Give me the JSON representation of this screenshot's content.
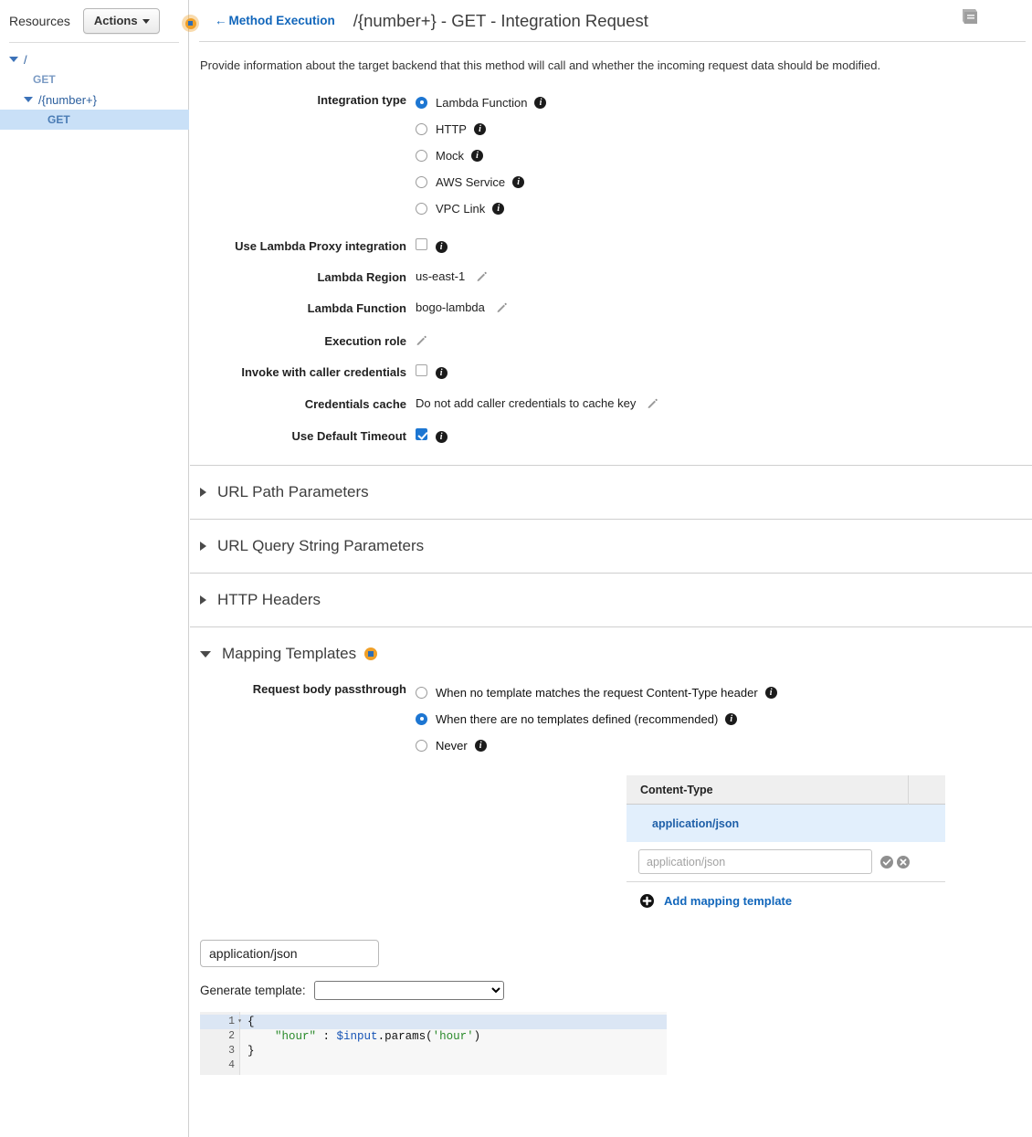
{
  "sidebar": {
    "title": "Resources",
    "actions_label": "Actions",
    "tree": [
      {
        "label": "/",
        "type": "resource",
        "expanded": true,
        "level": 0,
        "selected": false
      },
      {
        "label": "GET",
        "type": "method",
        "expanded": null,
        "level": 1,
        "selected": false
      },
      {
        "label": "/{number+}",
        "type": "resource",
        "expanded": true,
        "level": 2,
        "selected": false
      },
      {
        "label": "GET",
        "type": "method",
        "expanded": null,
        "level": 3,
        "selected": true
      }
    ]
  },
  "header": {
    "back_label": "Method Execution",
    "back_arrow": "←",
    "title": "/{number+} - GET - Integration Request",
    "doc_icon": "book-icon"
  },
  "intro": "Provide information about the target backend that this method will call and whether the incoming request data should be modified.",
  "form": {
    "integration_type": {
      "label": "Integration type",
      "options": [
        {
          "label": "Lambda Function",
          "selected": true
        },
        {
          "label": "HTTP",
          "selected": false
        },
        {
          "label": "Mock",
          "selected": false
        },
        {
          "label": "AWS Service",
          "selected": false
        },
        {
          "label": "VPC Link",
          "selected": false
        }
      ]
    },
    "lambda_proxy": {
      "label": "Use Lambda Proxy integration",
      "checked": false
    },
    "lambda_region": {
      "label": "Lambda Region",
      "value": "us-east-1"
    },
    "lambda_function": {
      "label": "Lambda Function",
      "value": "bogo-lambda"
    },
    "execution_role": {
      "label": "Execution role",
      "value": ""
    },
    "caller_credentials": {
      "label": "Invoke with caller credentials",
      "checked": false
    },
    "credentials_cache": {
      "label": "Credentials cache",
      "value": "Do not add caller credentials to cache key"
    },
    "default_timeout": {
      "label": "Use Default Timeout",
      "checked": true
    }
  },
  "sections": [
    {
      "title": "URL Path Parameters",
      "expanded": false,
      "marked": false
    },
    {
      "title": "URL Query String Parameters",
      "expanded": false,
      "marked": false
    },
    {
      "title": "HTTP Headers",
      "expanded": false,
      "marked": false
    },
    {
      "title": "Mapping Templates",
      "expanded": true,
      "marked": true
    }
  ],
  "mapping_templates": {
    "passthrough": {
      "label": "Request body passthrough",
      "options": [
        {
          "label": "When no template matches the request Content-Type header",
          "selected": false
        },
        {
          "label": "When there are no templates defined (recommended)",
          "selected": true
        },
        {
          "label": "Never",
          "selected": false
        }
      ]
    },
    "table": {
      "column_header": "Content-Type",
      "rows": [
        {
          "content_type": "application/json"
        }
      ],
      "new_row_value": "",
      "new_row_placeholder": "application/json",
      "confirm_icon": "check-circle-icon",
      "cancel_icon": "x-circle-icon"
    },
    "add_link": "Add mapping template",
    "add_icon": "plus-circle-icon"
  },
  "template_editor": {
    "name_value": "application/json",
    "generate_label": "Generate template:",
    "generate_value": "",
    "generate_options": [
      ""
    ],
    "code_lines": [
      {
        "num": "1",
        "active": true,
        "folded": true,
        "tokens": [
          {
            "t": "{",
            "c": "plain"
          }
        ]
      },
      {
        "num": "2",
        "active": false,
        "folded": false,
        "tokens": [
          {
            "t": "    ",
            "c": "plain"
          },
          {
            "t": "\"hour\"",
            "c": "str"
          },
          {
            "t": " : ",
            "c": "plain"
          },
          {
            "t": "$input",
            "c": "var"
          },
          {
            "t": ".params(",
            "c": "plain"
          },
          {
            "t": "'hour'",
            "c": "str"
          },
          {
            "t": ")",
            "c": "plain"
          }
        ]
      },
      {
        "num": "3",
        "active": false,
        "folded": false,
        "tokens": [
          {
            "t": "}",
            "c": "plain"
          }
        ]
      },
      {
        "num": "4",
        "active": false,
        "folded": false,
        "tokens": [
          {
            "t": "",
            "c": "plain"
          }
        ]
      }
    ]
  },
  "colors": {
    "link": "#1166bb",
    "accent_blue": "#1d76d2",
    "marker_orange": "#f0a028",
    "selected_row": "#e2effc",
    "tree_selected": "#c9e0f7"
  }
}
